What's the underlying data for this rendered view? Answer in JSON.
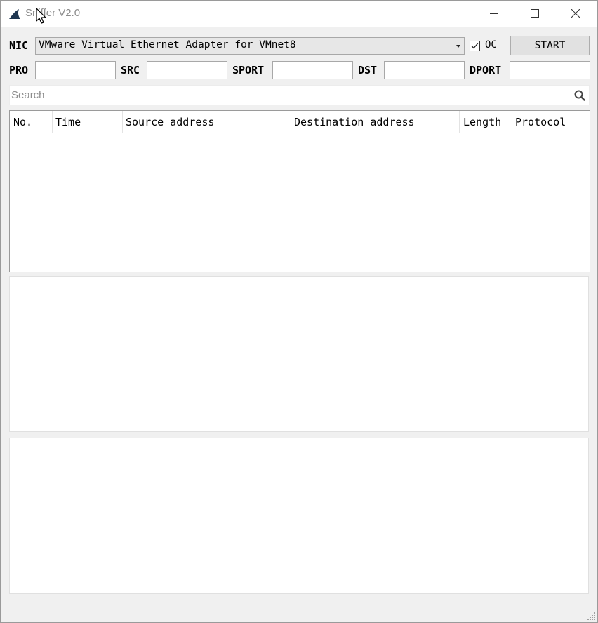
{
  "window": {
    "title": "Sniffer V2.0"
  },
  "controls": {
    "nic_label": "NIC",
    "nic_selected": "VMware Virtual Ethernet Adapter for VMnet8",
    "oc_label": "OC",
    "oc_checked": true,
    "start_label": "START"
  },
  "filters": {
    "pro_label": "PRO",
    "src_label": "SRC",
    "sport_label": "SPORT",
    "dst_label": "DST",
    "dport_label": "DPORT",
    "pro_value": "",
    "src_value": "",
    "sport_value": "",
    "dst_value": "",
    "dport_value": ""
  },
  "search": {
    "placeholder": "Search"
  },
  "packet_table": {
    "columns": [
      "No.",
      "Time",
      "Source address",
      "Destination address",
      "Length",
      "Protocol"
    ],
    "rows": []
  },
  "icons": {
    "app": "shark-fin-icon",
    "minimize": "minimize-icon",
    "maximize": "maximize-icon",
    "close": "close-icon",
    "search": "search-icon",
    "dropdown": "chevron-down-icon",
    "checkmark": "checkmark-icon",
    "resize": "resize-grip-icon"
  }
}
